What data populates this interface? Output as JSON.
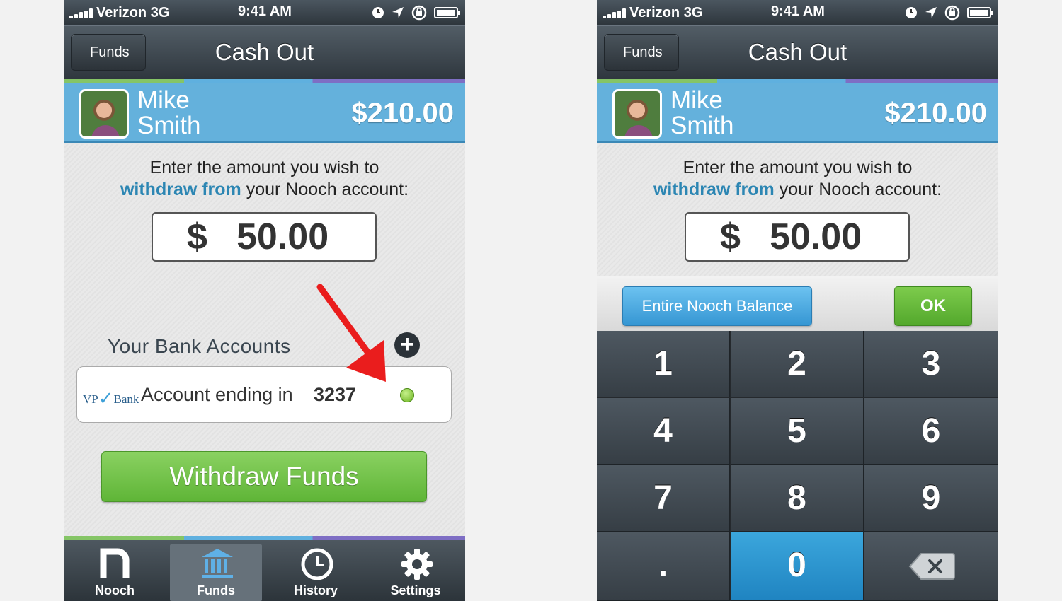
{
  "status": {
    "carrier": "Verizon 3G",
    "time": "9:41 AM"
  },
  "nav": {
    "back_label": "Funds",
    "title": "Cash Out"
  },
  "user": {
    "first_name": "Mike",
    "last_name": "Smith",
    "balance": "$210.00"
  },
  "prompt": {
    "line1": "Enter the amount you wish to",
    "highlight": "withdraw from",
    "line2_rest": "your Nooch account:"
  },
  "amount": {
    "currency": "$",
    "value": "50.00"
  },
  "banks": {
    "label": "Your Bank Accounts",
    "account": {
      "bank_logo": "VP Bank",
      "text": "Account ending in",
      "number": "3237"
    }
  },
  "withdraw_label": "Withdraw Funds",
  "tabs": [
    {
      "label": "Nooch",
      "icon": "nooch-icon"
    },
    {
      "label": "Funds",
      "icon": "bank-icon",
      "active": true
    },
    {
      "label": "History",
      "icon": "clock-icon"
    },
    {
      "label": "Settings",
      "icon": "gear-icon"
    }
  ],
  "keypad": {
    "entire_label": "Entire Nooch Balance",
    "ok_label": "OK",
    "keys": [
      "1",
      "2",
      "3",
      "4",
      "5",
      "6",
      "7",
      "8",
      "9",
      ".",
      "0"
    ]
  }
}
